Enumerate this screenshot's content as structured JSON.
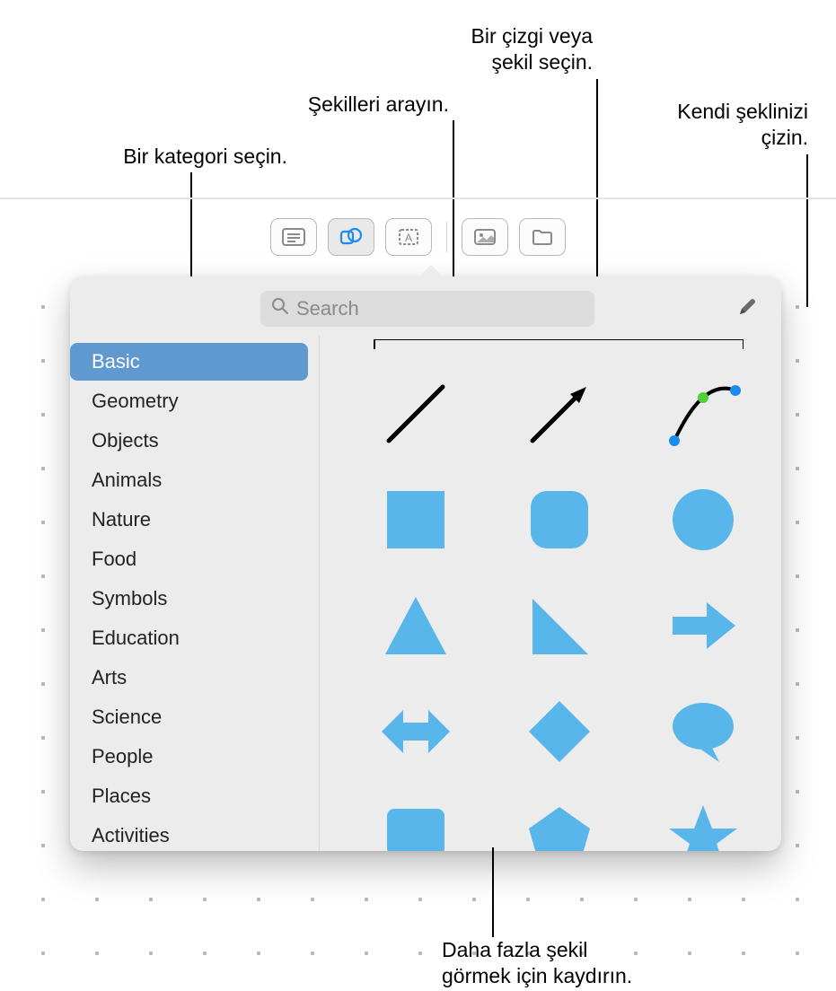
{
  "callouts": {
    "category": "Bir kategori seçin.",
    "search": "Şekilleri arayın.",
    "line_or_shape_l1": "Bir çizgi veya",
    "line_or_shape_l2": "şekil seçin.",
    "draw_own_l1": "Kendi şeklinizi",
    "draw_own_l2": "çizin.",
    "scroll_l1": "Daha fazla şekil",
    "scroll_l2": "görmek için kaydırın."
  },
  "search": {
    "placeholder": "Search"
  },
  "categories": [
    "Basic",
    "Geometry",
    "Objects",
    "Animals",
    "Nature",
    "Food",
    "Symbols",
    "Education",
    "Arts",
    "Science",
    "People",
    "Places",
    "Activities"
  ],
  "shapes": [
    "line",
    "arrow-line",
    "curve",
    "square",
    "rounded-square",
    "circle",
    "triangle",
    "right-triangle",
    "arrow-right",
    "double-arrow",
    "diamond",
    "speech-bubble",
    "callout-rect",
    "pentagon",
    "star"
  ]
}
